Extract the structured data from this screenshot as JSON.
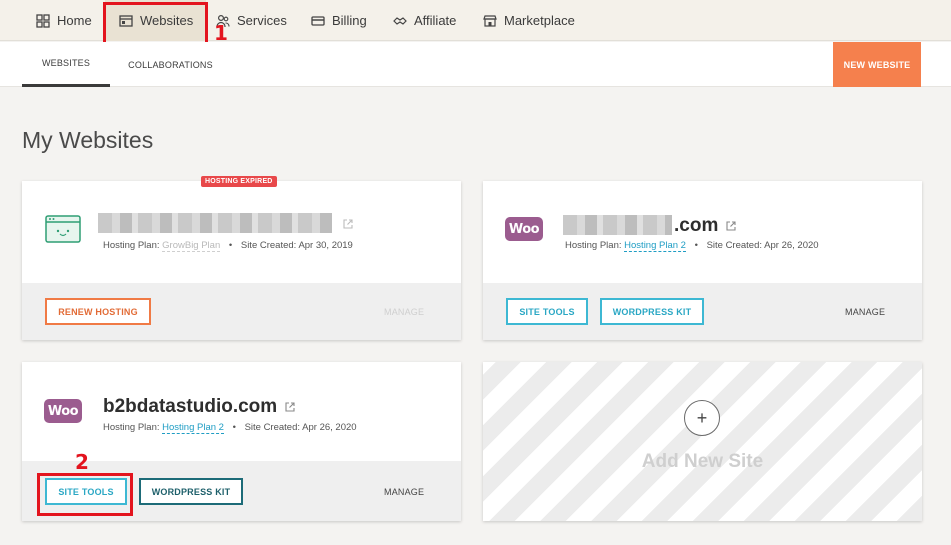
{
  "topnav": {
    "items": [
      {
        "label": "Home",
        "icon": "grid-icon"
      },
      {
        "label": "Websites",
        "icon": "browser-window-icon"
      },
      {
        "label": "Services",
        "icon": "people-icon"
      },
      {
        "label": "Billing",
        "icon": "credit-card-icon"
      },
      {
        "label": "Affiliate",
        "icon": "handshake-icon"
      },
      {
        "label": "Marketplace",
        "icon": "store-icon"
      }
    ]
  },
  "annotations": {
    "one": "1",
    "two": "2",
    "color": "#e3141e"
  },
  "subnav": {
    "tabs": [
      {
        "label": "WEBSITES"
      },
      {
        "label": "COLLABORATIONS"
      }
    ],
    "new_website": "NEW WEBSITE"
  },
  "page_title": "My Websites",
  "sites": [
    {
      "badge": "HOSTING EXPIRED",
      "domain": "",
      "plan_label": "Hosting Plan:",
      "plan": "GrowBig Plan",
      "created_label": "Site Created:",
      "created": "Apr 30, 2019",
      "dot": "•",
      "primary_button": "RENEW HOSTING",
      "manage": "MANAGE"
    },
    {
      "domain": ".com",
      "plan_label": "Hosting Plan:",
      "plan": "Hosting Plan 2",
      "created_label": "Site Created:",
      "created": "Apr 26, 2020",
      "dot": "•",
      "site_tools": "SITE TOOLS",
      "wordpress_kit": "WORDPRESS KIT",
      "manage": "MANAGE",
      "logo": "Woo"
    },
    {
      "domain": "b2bdatastudio.com",
      "plan_label": "Hosting Plan:",
      "plan": "Hosting Plan 2",
      "created_label": "Site Created:",
      "created": "Apr 26, 2020",
      "dot": "•",
      "site_tools": "SITE TOOLS",
      "wordpress_kit": "WORDPRESS KIT",
      "manage": "MANAGE",
      "logo": "Woo"
    }
  ],
  "add_site": {
    "plus": "+",
    "label": "Add New Site"
  },
  "colors": {
    "accent_orange": "#f5804d",
    "cyan": "#3db8d3",
    "teal": "#1d6b78",
    "expired": "#e8484a",
    "woo": "#9b5c8f"
  }
}
